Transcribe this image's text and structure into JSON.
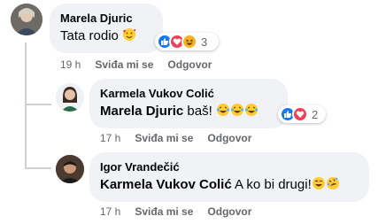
{
  "comments": [
    {
      "author": "Marela Djuric",
      "mention": "",
      "text": "Tata rodio",
      "reaction_count": "3",
      "time": "19 h",
      "like_label": "Sviđa mi se",
      "reply_label": "Odgovor"
    },
    {
      "author": "Karmela Vukov Colić",
      "mention": "Marela Djuric",
      "text": "baš!",
      "reaction_count": "2",
      "time": "17 h",
      "like_label": "Sviđa mi se",
      "reply_label": "Odgovor"
    },
    {
      "author": "Igor Vrandečić",
      "mention": "Karmela Vukov Colić",
      "text": "A ko bi drugi!",
      "reaction_count": "",
      "time": "17 h",
      "like_label": "Sviđa mi se",
      "reply_label": "Odgovor"
    }
  ],
  "icons": {
    "reactions_1": [
      "like-icon",
      "love-icon",
      "haha-icon"
    ],
    "reactions_2": [
      "like-icon",
      "love-icon"
    ]
  },
  "colors": {
    "bubble": "#f0f2f5",
    "like": "#1877f2",
    "love": "#f33e58",
    "meta": "#65676b"
  }
}
